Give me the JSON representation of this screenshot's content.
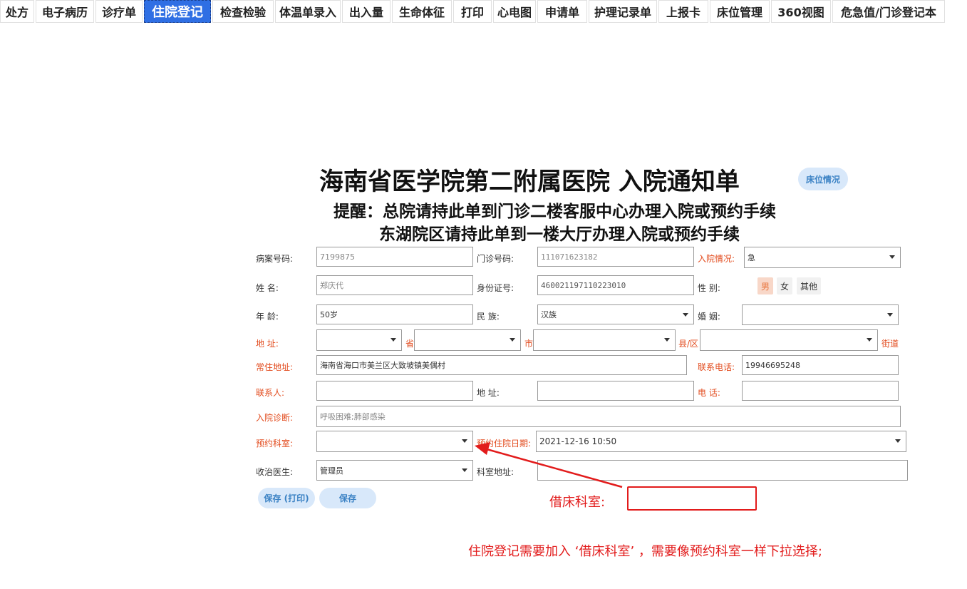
{
  "tabs": [
    {
      "label": "处方",
      "active": false
    },
    {
      "label": "电子病历",
      "active": false
    },
    {
      "label": "诊疗单",
      "active": false
    },
    {
      "label": "住院登记",
      "active": true
    },
    {
      "label": "检查检验",
      "active": false
    },
    {
      "label": "体温单录入",
      "active": false
    },
    {
      "label": "出入量",
      "active": false
    },
    {
      "label": "生命体征",
      "active": false
    },
    {
      "label": "打印",
      "active": false
    },
    {
      "label": "心电图",
      "active": false
    },
    {
      "label": "申请单",
      "active": false
    },
    {
      "label": "护理记录单",
      "active": false
    },
    {
      "label": "上报卡",
      "active": false
    },
    {
      "label": "床位管理",
      "active": false
    },
    {
      "label": "360视图",
      "active": false
    },
    {
      "label": "危急值/门诊登记本",
      "active": false
    }
  ],
  "header": {
    "title": "海南省医学院第二附属医院 入院通知单",
    "bed_status_button": "床位情况",
    "reminder_line1": "提醒：总院请持此单到门诊二楼客服中心办理入院或预约手续",
    "reminder_line2": "东湖院区请持此单到一楼大厅办理入院或预约手续"
  },
  "form": {
    "record_no_label": "病案号码:",
    "record_no": "7199875",
    "clinic_no_label": "门诊号码:",
    "clinic_no": "111071623182",
    "admission_status_label": "入院情况:",
    "admission_status": "急",
    "name_label": "姓  名:",
    "name": "郑庆代",
    "id_label": "身份证号:",
    "id_no": "460021197110223010",
    "gender_label": "性  别:",
    "gender_options": [
      "男",
      "女",
      "其他"
    ],
    "gender_selected": "男",
    "age_label": "年  龄:",
    "age": "50岁",
    "ethnicity_label": "民  族:",
    "ethnicity": "汉族",
    "marriage_label": "婚  姻:",
    "marriage": "",
    "address_label": "地  址:",
    "province_suffix": "省",
    "city_suffix": "市",
    "county_suffix": "县/区",
    "street_suffix": "街道",
    "permanent_address_label": "常住地址:",
    "permanent_address": "海南省海口市美兰区大致坡镇美偶村",
    "phone_label": "联系电话:",
    "phone": "19946695248",
    "contact_label": "联系人:",
    "contact": "",
    "contact_address_label": "地  址:",
    "contact_address": "",
    "contact_phone_label": "电  话:",
    "contact_phone": "",
    "diagnosis_label": "入院诊断:",
    "diagnosis": "呼吸困难;肺部感染",
    "reserve_dept_label": "预约科室:",
    "reserve_dept": "",
    "reserve_date_label": "预约住院日期:",
    "reserve_date": "2021-12-16 10:50",
    "doctor_label": "收治医生:",
    "doctor": "管理员",
    "dept_address_label": "科室地址:",
    "dept_address": "",
    "save_print_button": "保存 (打印)",
    "save_button": "保存"
  },
  "annotation": {
    "borrow_dept_label": "借床科室:",
    "note": "住院登记需要加入 ‘借床科室’ ，需要像预约科室一样下拉选择;",
    "color": "#e21b1b"
  },
  "colors": {
    "accent": "#2f6fe4",
    "required_label": "#e24a1c",
    "pill_bg": "#d8e8fa",
    "pill_text": "#3b82c4"
  }
}
